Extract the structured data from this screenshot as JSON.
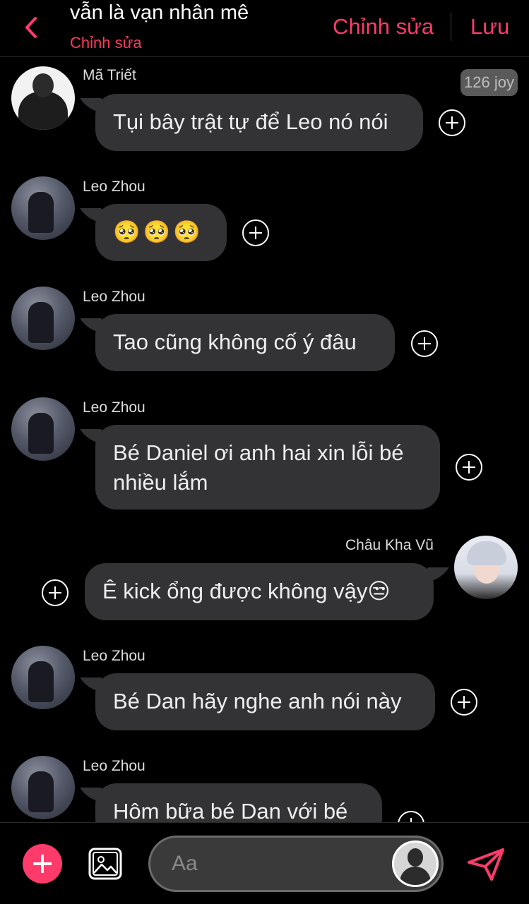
{
  "header": {
    "title": "vẫn là vạn nhân mê",
    "subtitle": "Chỉnh sửa",
    "edit_label": "Chỉnh sửa",
    "save_label": "Lưu"
  },
  "messages": [
    {
      "sender": "Mã Triết",
      "text": "Tụi bây trật tự để Leo nó nói",
      "badge": "126 joy"
    },
    {
      "sender": "Leo Zhou",
      "text": "🥺🥺🥺"
    },
    {
      "sender": "Leo Zhou",
      "text": "Tao cũng không cố ý đâu"
    },
    {
      "sender": "Leo Zhou",
      "text": "Bé Daniel ơi anh hai xin lỗi bé nhiều lắm",
      "line1": "Bé Daniel ơi anh hai xin lỗi bé",
      "line2": "nhiều lắm"
    },
    {
      "sender": "Châu Kha Vũ",
      "text": "Ê kick ổng được không vậy😒"
    },
    {
      "sender": "Leo Zhou",
      "text": "Bé Dan hãy nghe anh nói này"
    },
    {
      "sender": "Leo Zhou",
      "text": "Hôm bữa bé Dan với bé"
    }
  ],
  "composer": {
    "placeholder": "Aa"
  },
  "colors": {
    "accent": "#ff3b6b",
    "bubble": "#333335",
    "background": "#000000"
  },
  "icons": [
    "chevron-left-icon",
    "plus-circle-icon",
    "add-icon",
    "image-icon",
    "user-avatar-icon",
    "send-icon"
  ]
}
